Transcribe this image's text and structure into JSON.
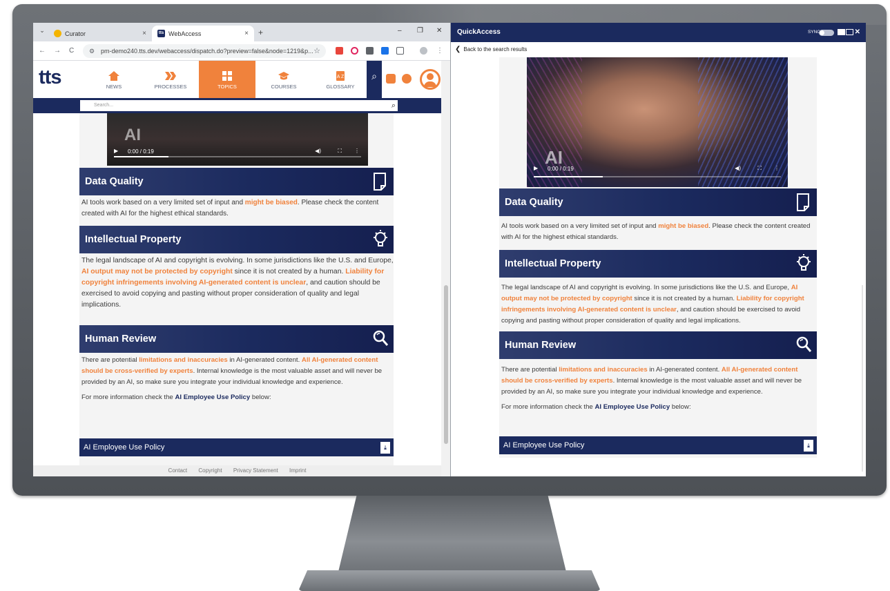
{
  "browser": {
    "tabs": [
      {
        "title": "Curator",
        "close": "×"
      },
      {
        "title": "WebAccess",
        "close": "×"
      }
    ],
    "new_tab": "+",
    "window_controls": {
      "minimize": "–",
      "restore": "❐",
      "close": "✕"
    },
    "url": "pm-demo240.tts.dev/webaccess/dispatch.do?preview=false&node=1219&p...",
    "nav": {
      "back": "←",
      "forward": "→",
      "reload": "C"
    }
  },
  "site": {
    "logo": "tts",
    "nav": [
      {
        "label": "NEWS"
      },
      {
        "label": "PROCESSES"
      },
      {
        "label": "TOPICS"
      },
      {
        "label": "COURSES"
      },
      {
        "label": "GLOSSARY"
      }
    ],
    "active_nav": "TOPICS",
    "search_placeholder": "Search...",
    "footer": [
      "Contact",
      "Copyright",
      "Privacy Statement",
      "Imprint"
    ]
  },
  "video": {
    "watermark": "AI",
    "time": "0:00 / 0:19",
    "progress_fraction": 0.22
  },
  "qa_video": {
    "watermark": "AI",
    "time": "0:00 / 0:19",
    "progress_fraction": 0.28
  },
  "sections": {
    "data_quality": {
      "title": "Data Quality",
      "t1": "AI tools work based on a very limited set of input and ",
      "h1": "might be biased",
      "t2": ". Please check the content created with AI for the highest ethical standards."
    },
    "ip": {
      "title": "Intellectual Property",
      "t1": "The legal landscape of AI and copyright is evolving. In some jurisdictions like the U.S. and Europe, ",
      "h1": "AI output may not be protected by copyright",
      "t2": " since it is not created by a human. ",
      "h2": "Liability for copyright infringements involving AI-generated content is unclear",
      "t3": ", and caution should be exercised to avoid copying and pasting without proper consideration of quality and legal implications."
    },
    "human_review": {
      "title": "Human Review",
      "t1": "There are potential ",
      "h1": "limitations and inaccuracies",
      "t2": " in AI-generated content. ",
      "h2": "All AI-generated content should be cross-verified by experts",
      "t3": ". Internal knowledge is the most valuable asset and will never be provided by an AI, so make sure you integrate your individual knowledge and experience.",
      "more_pre": "For more information check the ",
      "more_bold": "AI Employee Use Policy",
      "more_post": " below:"
    },
    "policy_link": "AI Employee Use Policy"
  },
  "quickaccess": {
    "title": "QuickAccess",
    "sync_label": "SYNC",
    "back_label": "Back to the search results"
  },
  "colors": {
    "navy": "#1b2a5e",
    "orange": "#f0823c"
  }
}
